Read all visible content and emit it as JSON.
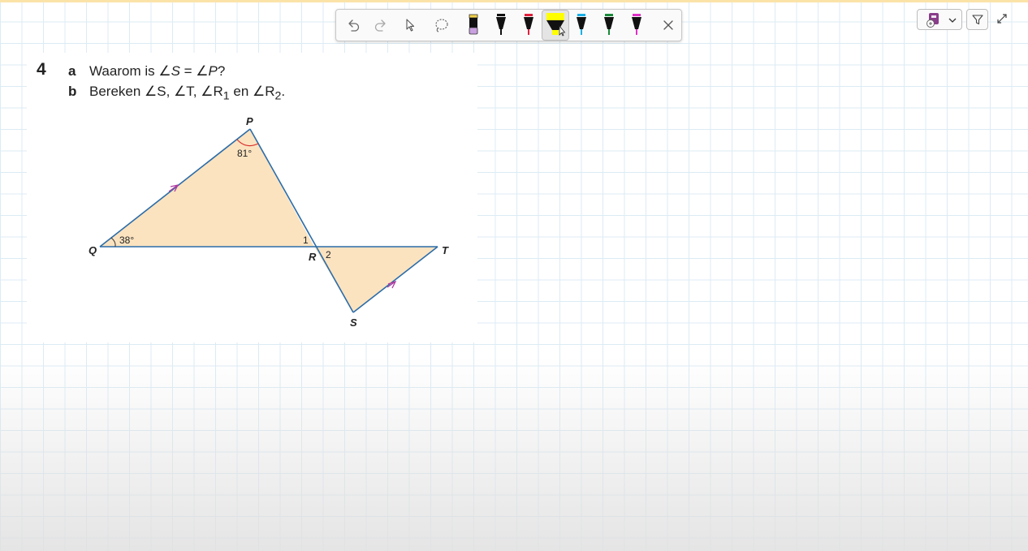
{
  "toolbar": {
    "tools": [
      "undo-icon",
      "redo-icon",
      "select-icon",
      "lasso-icon",
      "eraser-icon"
    ],
    "close": "close-icon",
    "pens": [
      {
        "name": "black-pen",
        "color": "#111111",
        "selected": false
      },
      {
        "name": "red-pen",
        "color": "#e0203c",
        "selected": false
      },
      {
        "name": "yellow-highlighter",
        "color": "#ffff00",
        "selected": true
      },
      {
        "name": "cyan-pen",
        "color": "#1ab0e8",
        "selected": false
      },
      {
        "name": "green-pen",
        "color": "#1a8a3a",
        "selected": false
      },
      {
        "name": "magenta-pen",
        "color": "#e030c8",
        "selected": false
      }
    ]
  },
  "controls": {
    "notebook": "notebook-icon",
    "filter": "filter-icon",
    "expand": "expand-icon"
  },
  "exercise": {
    "number": "4",
    "parts": [
      {
        "letter": "a",
        "text_before": "Waarom is ∠",
        "s": "S",
        "mid": " = ∠",
        "p": "P",
        "end": "?"
      },
      {
        "letter": "b",
        "text": "Bereken ∠S, ∠T, ∠R",
        "sub1": "1",
        "mid": " en ∠R",
        "sub2": "2",
        "end": "."
      }
    ]
  },
  "figure": {
    "vertices": {
      "P": "P",
      "Q": "Q",
      "R": "R",
      "S": "S",
      "T": "T"
    },
    "angle_labels": {
      "P": "81°",
      "Q": "38°",
      "R1": "1",
      "R2": "2"
    },
    "fill_color": "#fbe3c0",
    "line_color": "#2b6ca8",
    "arc_color": "#d8322e",
    "arrow_color": "#b03aa0"
  }
}
